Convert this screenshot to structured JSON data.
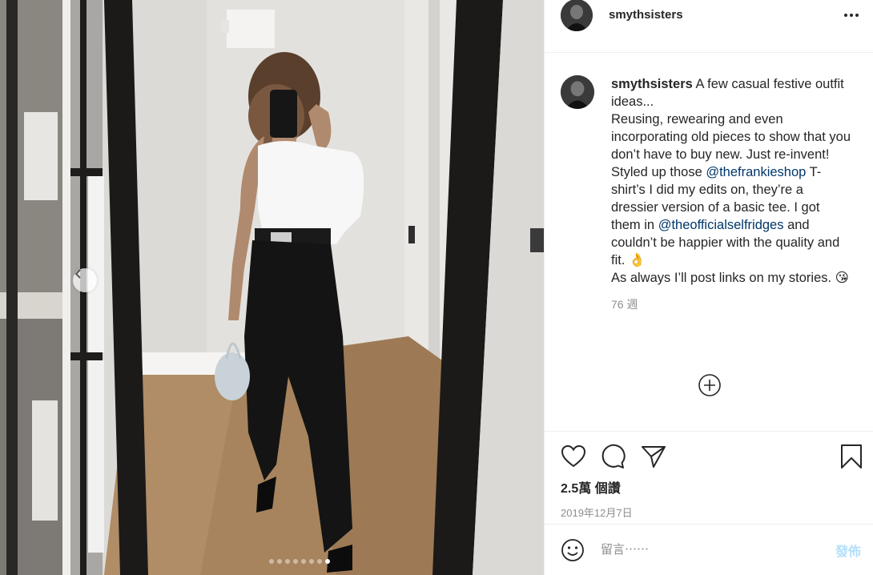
{
  "post": {
    "username": "smythsisters",
    "more_icon": "ellipsis-icon",
    "caption": {
      "username": "smythsisters",
      "line1": " A few casual festive outfit ideas...",
      "line2": "Reusing, rewearing and even incorporating old pieces to show that you don’t have to buy new. Just re-invent!",
      "line3_before": "Styled up those ",
      "mention1": "@thefrankieshop",
      "line3_after": " T-shirt’s I did my edits on, they’re a dressier version of a basic tee. I got them in ",
      "mention2": "@theofficialselfridges",
      "line3_end": " and couldn’t be happier with the quality and fit. 👌",
      "line4": "As always I’ll post links on my stories. 😘",
      "time_ago": "76 週"
    },
    "likes": "2.5萬 個讚",
    "date": "2019年12月7日",
    "comment_placeholder": "留言⋯⋯",
    "post_button": "發佈"
  },
  "carousel": {
    "total": 8,
    "active_index": 7
  },
  "colors": {
    "link": "#00376b",
    "post_button_disabled": "#b2dffc",
    "secondary_text": "#8e8e8e"
  }
}
